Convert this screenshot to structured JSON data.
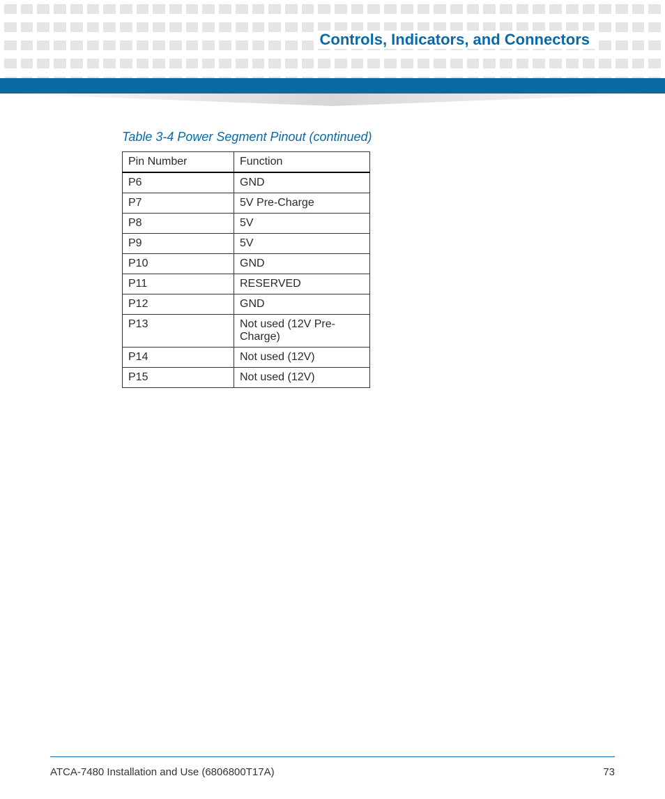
{
  "header": {
    "chapter_title": "Controls, Indicators, and Connectors"
  },
  "table": {
    "caption": "Table 3-4 Power Segment Pinout (continued)",
    "columns": [
      "Pin Number",
      "Function"
    ],
    "rows": [
      {
        "pin": "P6",
        "func": "GND"
      },
      {
        "pin": "P7",
        "func": "5V Pre-Charge"
      },
      {
        "pin": "P8",
        "func": "5V"
      },
      {
        "pin": "P9",
        "func": "5V"
      },
      {
        "pin": "P10",
        "func": "GND"
      },
      {
        "pin": "P11",
        "func": "RESERVED"
      },
      {
        "pin": "P12",
        "func": "GND"
      },
      {
        "pin": "P13",
        "func": "Not used (12V Pre-Charge)"
      },
      {
        "pin": "P14",
        "func": "Not used (12V)"
      },
      {
        "pin": "P15",
        "func": "Not used (12V)"
      }
    ]
  },
  "footer": {
    "doc_title": "ATCA-7480 Installation and Use (6806800T17A)",
    "page_number": "73"
  }
}
